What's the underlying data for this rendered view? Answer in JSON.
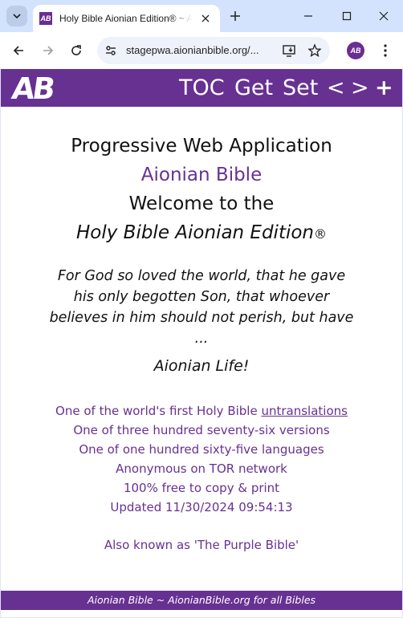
{
  "browser": {
    "tab_title": "Holy Bible Aionian Edition® ~ Aionian Bible",
    "favicon_text": "AB",
    "url": "stagepwa.aionianbible.org/...",
    "profile_initials": "AB"
  },
  "header": {
    "logo": "AB",
    "nav": {
      "toc": "TOC",
      "get": "Get",
      "set": "Set",
      "prev": "<",
      "next": ">",
      "plus": "+"
    }
  },
  "main": {
    "heading_pwa": "Progressive Web Application",
    "heading_aionian": "Aionian Bible",
    "heading_welcome": "Welcome to the",
    "heading_holy": "Holy Bible Aionian Edition",
    "heading_holy_reg": "®",
    "verse": "For God so loved the world, that he gave his only begotten Son, that whoever believes in him should not perish, but have ...",
    "aionian_life": "Aionian Life!",
    "facts": {
      "line1_prefix": "One of the world's first Holy Bible ",
      "line1_link": "untranslations",
      "line2": "One of three hundred seventy-six versions",
      "line3": "One of one hundred sixty-five languages",
      "line4": "Anonymous on TOR network",
      "line5": "100% free to copy & print",
      "line6": "Updated 11/30/2024 09:54:13"
    },
    "aka": "Also known as 'The Purple Bible'"
  },
  "footer": {
    "text": "Aionian Bible ~ AionianBible.org for all Bibles"
  },
  "colors": {
    "brand_purple": "#673192",
    "chrome_tabstrip": "#d3e3fd"
  },
  "icons": [
    "chevron-down-icon",
    "close-icon",
    "plus-icon",
    "minimize-icon",
    "maximize-icon",
    "back-arrow-icon",
    "forward-arrow-icon",
    "reload-icon",
    "site-settings-icon",
    "install-app-icon",
    "star-icon",
    "more-vert-icon"
  ]
}
